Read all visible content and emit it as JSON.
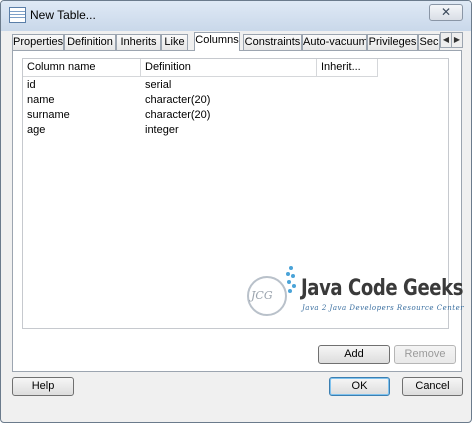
{
  "window": {
    "title": "New Table...",
    "close_glyph": "✕"
  },
  "tabs": [
    {
      "label": "Properties"
    },
    {
      "label": "Definition"
    },
    {
      "label": "Inherits"
    },
    {
      "label": "Like"
    },
    {
      "label": "Columns",
      "active": true
    },
    {
      "label": "Constraints"
    },
    {
      "label": "Auto-vacuum"
    },
    {
      "label": "Privileges"
    },
    {
      "label": "Sec"
    }
  ],
  "tab_scroll": {
    "left": "◀",
    "right": "▶"
  },
  "grid": {
    "headers": [
      "Column name",
      "Definition",
      "Inherit..."
    ],
    "rows": [
      [
        "id",
        "serial"
      ],
      [
        "name",
        "character(20)"
      ],
      [
        "surname",
        "character(20)"
      ],
      [
        "age",
        "integer"
      ]
    ]
  },
  "watermark": {
    "logo": "JCG",
    "title": "Java Code Geeks",
    "subtitle": "Java 2 Java Developers Resource Center"
  },
  "buttons": {
    "add": "Add",
    "remove": "Remove",
    "help": "Help",
    "ok": "OK",
    "cancel": "Cancel"
  },
  "colors": {
    "titlebar": "#c9d8ea",
    "accent": "#3c7fb1",
    "watermark_dots": "#4aa3d8"
  }
}
